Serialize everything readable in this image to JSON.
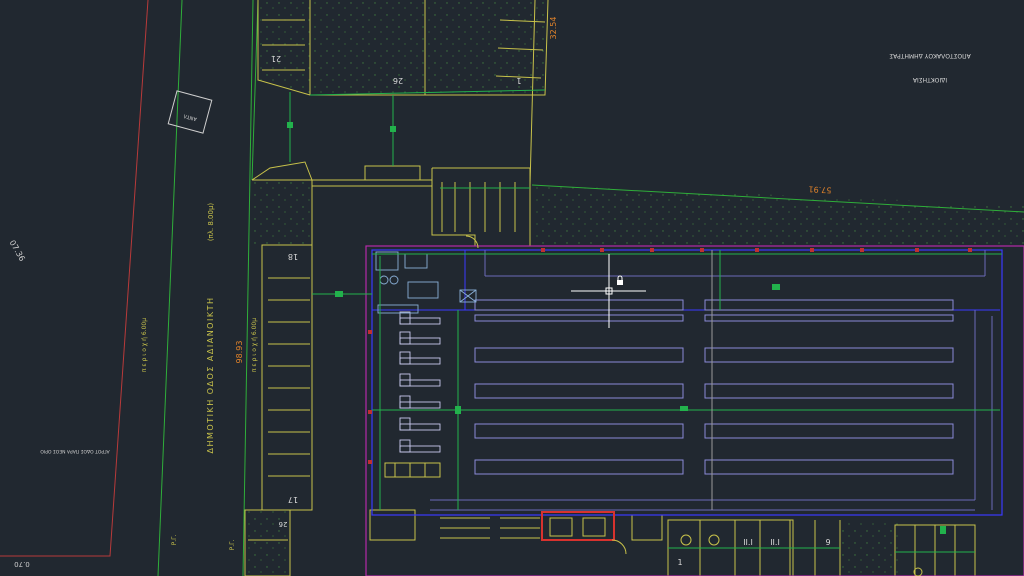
{
  "title_block": {
    "line1": "ΙΔΙΟΚΤΗΣΙΑ",
    "line2": "ΑΠΟΣΤΟΛΑΚΟΥ ΔΗΜΗΤΡΑΣ"
  },
  "road_label": "ΔΗΜΟΤΙΚΗ ΟΔΟΣ ΑΔΙΑΝΟΙΚΤΗ",
  "road_width": "(πλ. 8.00μ)",
  "sidewalk_left": "π ε ρ ι ο χ ή   6.00μ",
  "sidewalk_right": "π ε ρ ι ο χ ή   6.00μ",
  "property_note": "ΑΓΡΟΤ ΟΔΟΣ ΠΑΡΑ ΝΕΟΣ ΟΡΙΟ",
  "box_label": "ΑΝΤΛ",
  "pg_label": "Ρ.Γ.",
  "dimensions": {
    "d1": "32.54",
    "d2": "57.91",
    "d3": "98.93",
    "d4": "07.36",
    "d5": "0.70"
  },
  "parking_numbers": {
    "p21": "21",
    "p26": "26",
    "p1": "1",
    "p18": "18",
    "p17": "17",
    "p26b": "26",
    "p1b": "1",
    "p9": "9",
    "p_ii1": "II.I",
    "p_ii2": "II.I"
  },
  "colors": {
    "background": "#212830",
    "linework": "#c8c24a",
    "green": "#22b24c",
    "blue": "#3a3aff",
    "magenta": "#b42aa8",
    "red_outline": "#d8322e",
    "orange_dim": "#e0822a",
    "cursor": "#ffffff"
  }
}
